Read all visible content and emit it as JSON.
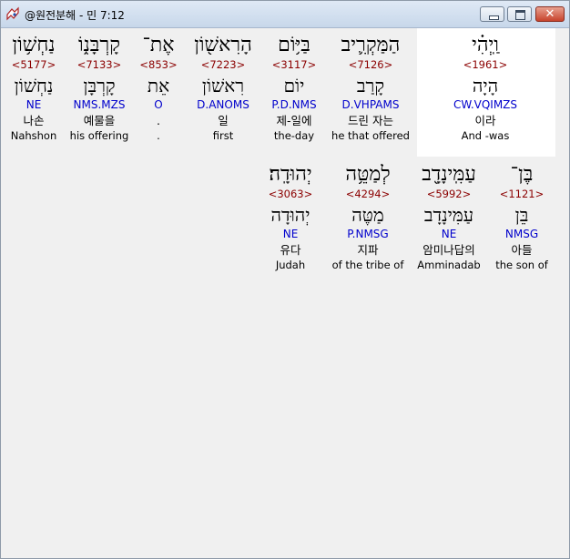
{
  "window": {
    "title": "@원전분해 - 민 7:12"
  },
  "rows": [
    [
      {
        "heb": "נַחְשׁ֥וֹן",
        "strong": "<5177>",
        "lemma": "נַחְשׁוֹן",
        "morph": "NE",
        "kor": "나손",
        "eng": "Nahshon"
      },
      {
        "heb": "קָרְבָּנ֑וֹ",
        "strong": "<7133>",
        "lemma": "קָרְבָּן",
        "morph": "NMS.MZS",
        "kor": "예물을",
        "eng": "his offering"
      },
      {
        "heb": "אֶת־",
        "strong": "<853>",
        "lemma": "אֵת",
        "morph": "O",
        "kor": ".",
        "eng": "."
      },
      {
        "heb": "הָרִאשׁ֖וֹן",
        "strong": "<7223>",
        "lemma": "רִאשׁוֹן",
        "morph": "D.ANOMS",
        "kor": "일",
        "eng": "first"
      },
      {
        "heb": "בַּיּ֥וֹם",
        "strong": "<3117>",
        "lemma": "יוֹם",
        "morph": "P.D.NMS",
        "kor": "제-일에",
        "eng": "the-day"
      },
      {
        "heb": "הַמַּקְרִ֛יב",
        "strong": "<7126>",
        "lemma": "קָרַב",
        "morph": "D.VHPAMS",
        "kor": "드린 자는",
        "eng": "he that offered"
      },
      {
        "heb": "וַֽיְהִ֗י",
        "strong": "<1961>",
        "lemma": "הָיָה",
        "morph": "CW.VQIMZS",
        "kor": "이라",
        "eng": "And -was"
      }
    ],
    [
      {
        "heb": "יְהוּדָֽה׃",
        "strong": "<3063>",
        "lemma": "יְהוּדָה",
        "morph": "NE",
        "kor": "유다",
        "eng": "Judah"
      },
      {
        "heb": "לְמַטֵּ֥ה",
        "strong": "<4294>",
        "lemma": "מַטֶּה",
        "morph": "P.NMSG",
        "kor": "지파",
        "eng": "of the tribe of"
      },
      {
        "heb": "עַמִּֽינָדָ֖ב",
        "strong": "<5992>",
        "lemma": "עַמִּינָדָב",
        "morph": "NE",
        "kor": "암미나답의",
        "eng": "Amminadab"
      },
      {
        "heb": "בֶּן־",
        "strong": "<1121>",
        "lemma": "בֵּן",
        "morph": "NMSG",
        "kor": "아들",
        "eng": "the son of"
      }
    ]
  ],
  "colors": {
    "strong": "#8b0000",
    "morph": "#0000cc",
    "highlight": "#ffffff"
  }
}
